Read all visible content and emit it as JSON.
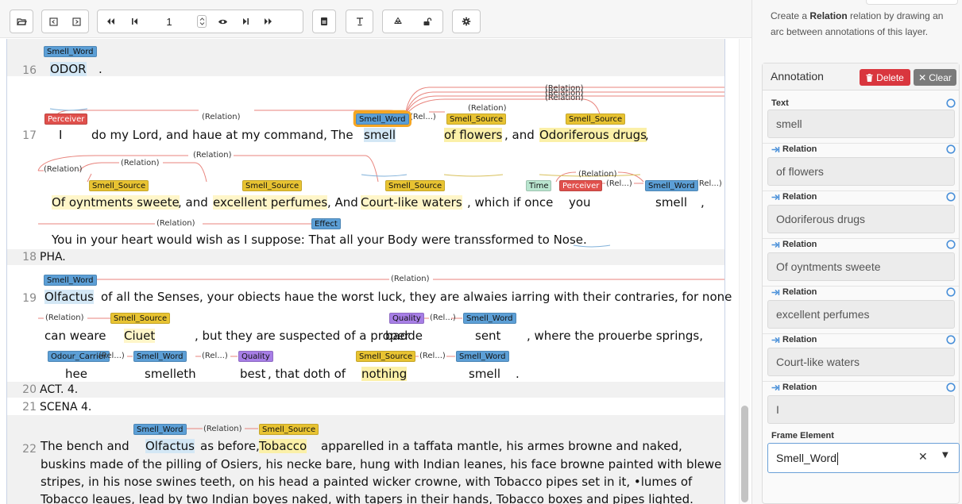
{
  "toolbar": {
    "page_number": "1",
    "buttons": [
      "folder-open",
      "prev-document",
      "next-document",
      "first-page",
      "previous-page",
      "next-page",
      "last-page",
      "eye",
      "save",
      "font-size",
      "recycle",
      "unlock",
      "settings"
    ]
  },
  "document": {
    "line_numbers": {
      "l16": "16",
      "l17": "17",
      "l18": "18",
      "l19": "19",
      "l20": "20",
      "l21": "21",
      "l22": "22"
    },
    "line16": {
      "label": "Smell_Word",
      "word": "ODOR",
      "punct": "."
    },
    "line17": {
      "labels": {
        "perceiver": "Perceiver",
        "smell_word": "Smell_Word",
        "ss1": "Smell_Source",
        "ss2": "Smell_Source"
      },
      "rels": {
        "r1": "(Relation)",
        "r2": "(Rel...)",
        "r3": "(Relation)",
        "r4": "(Relation)",
        "r5": "(Relation)",
        "r6": "(Relation)"
      },
      "t_i": "I",
      "t_mid": "do my Lord, and haue at my command, The",
      "t_smell": "smell",
      "t_of_flowers": "of flowers",
      "t_and": ", and",
      "t_odor": "Odoriferous drugs",
      "t_comma": ","
    },
    "line17b": {
      "labels": {
        "ss1": "Smell_Source",
        "ss2": "Smell_Source",
        "ss3": "Smell_Source",
        "time": "Time",
        "perceiver": "Perceiver",
        "smell_word": "Smell_Word"
      },
      "rels": {
        "r1": "(Relation)",
        "r2": "(Relation)",
        "r3": "(Relation)",
        "r4": "(Relation)",
        "r5": "(Rel...)",
        "r6": "(Rel...)"
      },
      "t1": "Of oyntments sweete",
      "t2": ", and",
      "t3": "excellent perfumes",
      "t4": ", And",
      "t5": "Court-like waters",
      "t6": ", which if once",
      "t7": "you",
      "t8": "smell",
      "t9": ","
    },
    "line17c": {
      "labels": {
        "effect": "Effect"
      },
      "rels": {
        "r1": "(Relation)"
      },
      "text": "You in your heart would wish as I suppose: That all your Body were transsformed to Nose."
    },
    "line18": {
      "text": "PHA."
    },
    "line19": {
      "labels": {
        "smell_word": "Smell_Word"
      },
      "rels": {
        "r1": "(Relation)"
      },
      "t1": "Olfactus",
      "t2": "of all the Senses, your obiects haue the worst luck, they are alwaies iarring with their contraries, for none"
    },
    "line19b": {
      "labels": {
        "ss": "Smell_Source",
        "quality": "Quality",
        "smell_word": "Smell_Word"
      },
      "rels": {
        "r1": "(Relation)",
        "r2": "(Rel...)"
      },
      "t1": "can weare",
      "t2": "Ciuet",
      "t3": ", but they are suspected of a proper",
      "t4": "badde",
      "t5": "sent",
      "t6": ", where the prouerbe springs,"
    },
    "line19c": {
      "labels": {
        "odour": "Odour_Carrier",
        "smell_word": "Smell_Word",
        "quality": "Quality",
        "ss": "Smell_Source",
        "smell_word2": "Smell_Word"
      },
      "rels": {
        "r1": "(Rel...)",
        "r2": "(Rel...)",
        "r3": "(Rel...)"
      },
      "t1": "hee",
      "t2": "smelleth",
      "t3": "best",
      "t4": ", that doth of",
      "t5": "nothing",
      "t6": "smell",
      "t7": "."
    },
    "line20": {
      "text": "ACT. 4."
    },
    "line21": {
      "text": "SCENA 4."
    },
    "line22": {
      "labels": {
        "smell_word": "Smell_Word",
        "ss": "Smell_Source"
      },
      "rels": {
        "r1": "(Relation)"
      },
      "t1": "The bench and",
      "t2": "Olfactus",
      "t3": "as before,",
      "t4": "Tobacco",
      "t5": "apparelled in a taffata mantle, his armes browne and naked,",
      "t6": "buskins made of the pilling of Osiers, his necke bare, hung with Indian leanes, his face browne painted with blewe",
      "t7": "stripes, in his nose swines teeth, on his head a painted wicker crowne, with Tobacco pipes set in it, •lumes of",
      "t8": "Tobacco leaues, lead by two Indian boyes naked, with tapers in their hands, Tobacco boxes and pipes lighted."
    }
  },
  "panel": {
    "hint_pre": "Create a ",
    "hint_bold": "Relation",
    "hint_post": " relation by drawing an arc between annotations of this layer.",
    "annotation_title": "Annotation",
    "delete_label": "Delete",
    "clear_label": "Clear",
    "text_label": "Text",
    "text_value": "smell",
    "relation_label": "Relation",
    "relations": [
      "of flowers",
      "Odoriferous drugs",
      "Of oyntments sweete",
      "excellent perfumes",
      "Court-like waters",
      "I"
    ],
    "frame_element_label": "Frame Element",
    "frame_element_value": "Smell_Word"
  },
  "colors": {
    "smell_word": "#5c9fd6",
    "smell_source": "#e8c332",
    "perceiver": "#e0504c",
    "quality": "#a77ee6",
    "time": "#b9e5cf",
    "delete": "#d9363e",
    "arc": "#e8837c"
  }
}
